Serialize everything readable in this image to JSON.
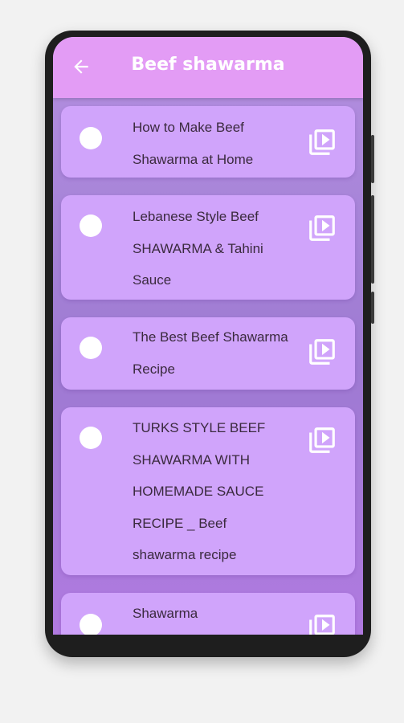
{
  "header": {
    "title": "Beef shawarma",
    "back_icon": "arrow-left-icon"
  },
  "items": [
    {
      "text": "How to Make Beef Shawarma at Home"
    },
    {
      "text": "Lebanese Style Beef SHAWARMA & Tahini Sauce"
    },
    {
      "text": "The Best Beef Shawarma Recipe"
    },
    {
      "text": "TURKS STYLE BEEF SHAWARMA WITH HOMEMADE SAUCE RECIPE _ Beef shawarma recipe"
    },
    {
      "text": "Shawarma"
    }
  ],
  "colors": {
    "appbar": "#e39cf5",
    "card": "#d0a4fb",
    "text": "#3a2a3e"
  },
  "item_icon": "video-library-icon"
}
